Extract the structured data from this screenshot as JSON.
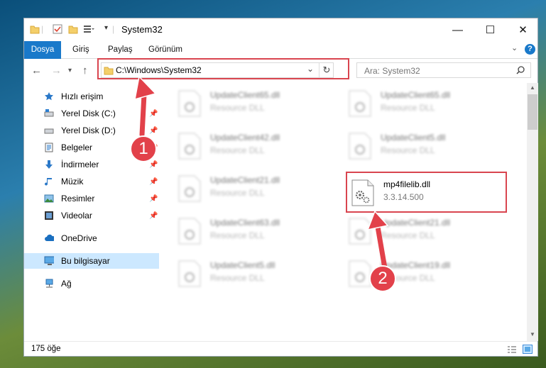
{
  "window": {
    "title": "System32",
    "tabs": [
      {
        "label": "Dosya"
      },
      {
        "label": "Giriş"
      },
      {
        "label": "Paylaş"
      },
      {
        "label": "Görünüm"
      }
    ],
    "controls": {
      "minimize": "—",
      "maximize": "☐",
      "close": "✕"
    }
  },
  "address_bar": {
    "path": "C:\\Windows\\System32",
    "search_placeholder": "Ara: System32"
  },
  "sidebar": {
    "items": [
      {
        "label": "Hızlı erişim",
        "icon": "star-icon",
        "pinned": false
      },
      {
        "label": "Yerel Disk (C:)",
        "icon": "drive-icon",
        "pinned": true
      },
      {
        "label": "Yerel Disk (D:)",
        "icon": "drive-icon",
        "pinned": true
      },
      {
        "label": "Belgeler",
        "icon": "documents-icon",
        "pinned": true
      },
      {
        "label": "İndirmeler",
        "icon": "download-icon",
        "pinned": true
      },
      {
        "label": "Müzik",
        "icon": "music-icon",
        "pinned": true
      },
      {
        "label": "Resimler",
        "icon": "pictures-icon",
        "pinned": true
      },
      {
        "label": "Videolar",
        "icon": "video-icon",
        "pinned": true
      },
      {
        "label": "OneDrive",
        "icon": "cloud-icon",
        "pinned": false
      },
      {
        "label": "Bu bilgisayar",
        "icon": "computer-icon",
        "pinned": false,
        "selected": true
      },
      {
        "label": "Ağ",
        "icon": "network-icon",
        "pinned": false
      }
    ]
  },
  "files": [
    {
      "name": "UpdateClient65.dll",
      "desc": "Resource DLL",
      "blurred": true
    },
    {
      "name": "UpdateClient65.dll",
      "desc": "Resource DLL",
      "blurred": true
    },
    {
      "name": "UpdateClient42.dll",
      "desc": "Resource DLL",
      "blurred": true
    },
    {
      "name": "UpdateClient5.dll",
      "desc": "Resource DLL",
      "blurred": true
    },
    {
      "name": "UpdateClient21.dll",
      "desc": "Resource DLL",
      "blurred": true
    },
    {
      "name": "mp4filelib.dll",
      "desc": "3.3.14.500",
      "blurred": false
    },
    {
      "name": "UpdateClient63.dll",
      "desc": "Resource DLL",
      "blurred": true
    },
    {
      "name": "UpdateClient21.dll",
      "desc": "Resource DLL",
      "blurred": true
    },
    {
      "name": "UpdateClient5.dll",
      "desc": "Resource DLL",
      "blurred": true
    },
    {
      "name": "UpdateClient19.dll",
      "desc": "Resource DLL",
      "blurred": true
    }
  ],
  "status": {
    "item_count": "175 öğe"
  },
  "annotations": {
    "step1": "1",
    "step2": "2",
    "color": "#e2414a"
  }
}
